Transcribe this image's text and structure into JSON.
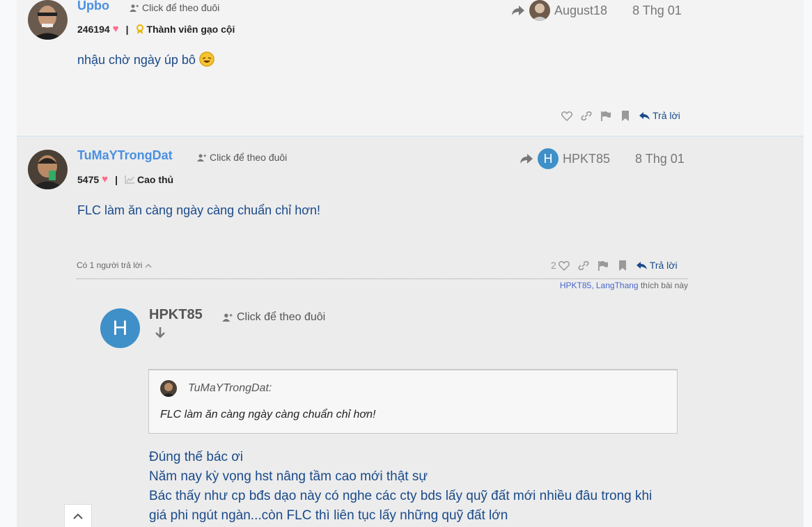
{
  "post1": {
    "username": "Upbo",
    "follow_label": "Click để theo đuôi",
    "likes": "246194",
    "rank": "Thành viên gạo cội",
    "replied_to": "August18",
    "date": "8 Thg 01",
    "body": "nhậu chờ ngày úp bô",
    "reply_label": "Trả lời"
  },
  "post2": {
    "username": "TuMaYTrongDat",
    "follow_label": "Click để theo đuôi",
    "likes": "5475",
    "rank": "Cao thủ",
    "replied_to": "HPKT85",
    "replied_to_initial": "H",
    "date": "8 Thg 01",
    "body": "FLC làm ăn càng ngày càng chuẩn chỉ hơn!",
    "replies_count_label": "Có 1 người trả lời",
    "like_count": "2",
    "reply_label": "Trả lời",
    "liked_by": [
      "HPKT85",
      "LangThang"
    ],
    "liked_by_suffix": "thích bài này"
  },
  "nested_reply": {
    "avatar_initial": "H",
    "username": "HPKT85",
    "follow_label": "Click để theo đuôi",
    "quote_author": "TuMaYTrongDat:",
    "quote_text": "FLC làm ăn càng ngày càng chuẩn chỉ hơn!",
    "lines": [
      "Đúng thế bác ơi",
      "Năm nay kỳ vọng hst nâng tầm cao mới thật sự",
      "Bác thấy như cp bđs dạo này có nghe các cty bds lấy quỹ đất mới nhiều đâu trong khi",
      "giá phi ngút ngàn...còn FLC thì liên tục lấy những quỹ đất lớn"
    ]
  },
  "colors": {
    "username": "#4a90e2",
    "body_text": "#1a4a8a",
    "heart": "#ff6b8a",
    "avatar_blue": "#3f90c8"
  }
}
